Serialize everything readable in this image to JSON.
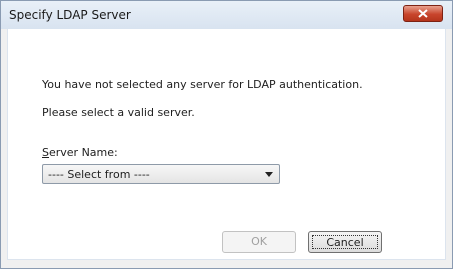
{
  "window": {
    "title": "Specify LDAP Server"
  },
  "message": {
    "line1": "You have not selected any server for LDAP authentication.",
    "line2": "Please select a valid server."
  },
  "server_name": {
    "label_accel": "S",
    "label_rest": "erver Name:",
    "selected": "---- Select from ----"
  },
  "buttons": {
    "ok": "OK",
    "cancel": "Cancel"
  },
  "colors": {
    "close_button": "#c8452c",
    "title_bar": "#dfe8f3"
  }
}
